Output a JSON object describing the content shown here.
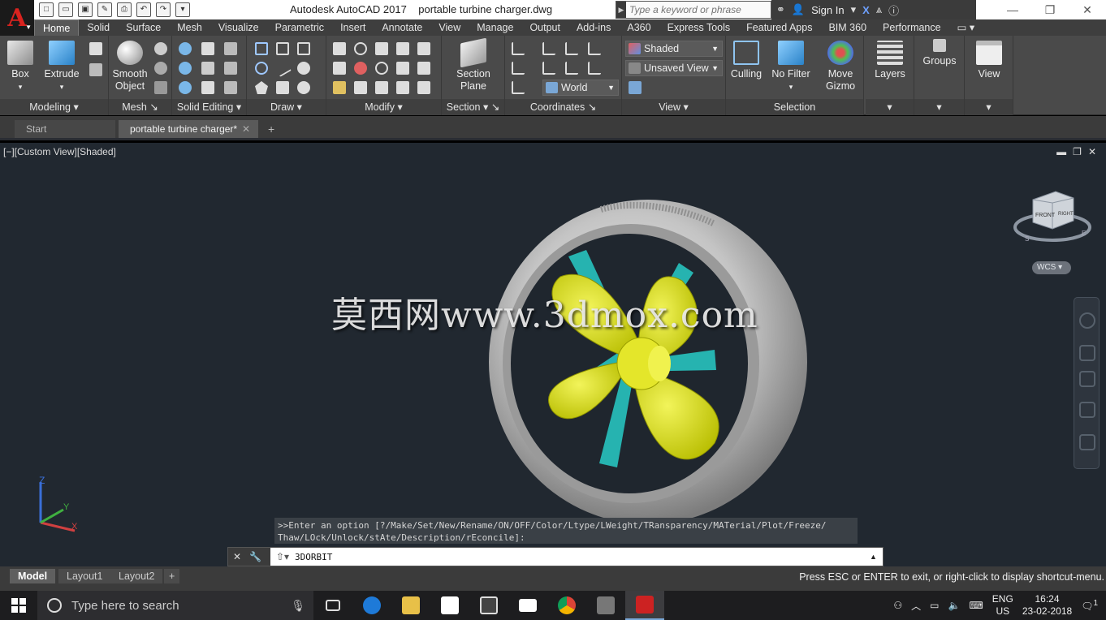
{
  "titlebar": {
    "app_title": "Autodesk AutoCAD 2017",
    "file_title": "portable turbine charger.dwg",
    "search_placeholder": "Type a keyword or phrase",
    "sign_in": "Sign In"
  },
  "tabs": [
    "Home",
    "Solid",
    "Surface",
    "Mesh",
    "Visualize",
    "Parametric",
    "Insert",
    "Annotate",
    "View",
    "Manage",
    "Output",
    "Add-ins",
    "A360",
    "Express Tools",
    "Featured Apps",
    "BIM 360",
    "Performance"
  ],
  "ribbon": {
    "modeling": {
      "title": "Modeling",
      "box": "Box",
      "extrude": "Extrude"
    },
    "mesh": {
      "title": "Mesh",
      "smooth_object": "Smooth Object"
    },
    "solid_editing": {
      "title": "Solid Editing"
    },
    "draw": {
      "title": "Draw"
    },
    "modify": {
      "title": "Modify"
    },
    "section": {
      "title": "Section",
      "section_plane": "Section Plane"
    },
    "coordinates": {
      "title": "Coordinates",
      "world": "World"
    },
    "view": {
      "title": "View",
      "visual_style": "Shaded",
      "named_view": "Unsaved View"
    },
    "selection": {
      "title": "Selection",
      "culling": "Culling",
      "no_filter": "No Filter",
      "move_gizmo": "Move Gizmo"
    },
    "layers": "Layers",
    "groups": "Groups",
    "view_big": "View"
  },
  "filetabs": {
    "start": "Start",
    "document": "portable turbine charger*"
  },
  "viewport": {
    "label": "[−][Custom View][Shaded]",
    "watermark": "莫西网www.3dmox.com",
    "wcs": "WCS",
    "viewcube_front": "FRONT",
    "viewcube_right": "RIGHT",
    "compass": [
      "S",
      "E"
    ],
    "ucs_x": "X",
    "ucs_y": "Y",
    "ucs_z": "Z"
  },
  "command": {
    "history_line1": ">>Enter an option [?/Make/Set/New/Rename/ON/OFF/Color/Ltype/LWeight/TRansparency/MATerial/Plot/Freeze/",
    "history_line2": "Thaw/LOck/Unlock/stAte/Description/rEconcile]:",
    "current": "3DORBIT"
  },
  "layout_tabs": [
    "Model",
    "Layout1",
    "Layout2"
  ],
  "status_message": "Press ESC or ENTER to exit, or right-click to display shortcut-menu.",
  "taskbar": {
    "search_placeholder": "Type here to search",
    "lang1": "ENG",
    "lang2": "US",
    "time": "16:24",
    "date": "23-02-2018",
    "notifications": "1"
  },
  "colors": {
    "viewport_bg": "#212830",
    "ribbon_bg": "#4a4a4a",
    "blade_yellow": "#d7dc10",
    "spoke_teal": "#26b3b0",
    "tire_gray": "#c9c9c9",
    "autocad_red": "#d9231f"
  }
}
